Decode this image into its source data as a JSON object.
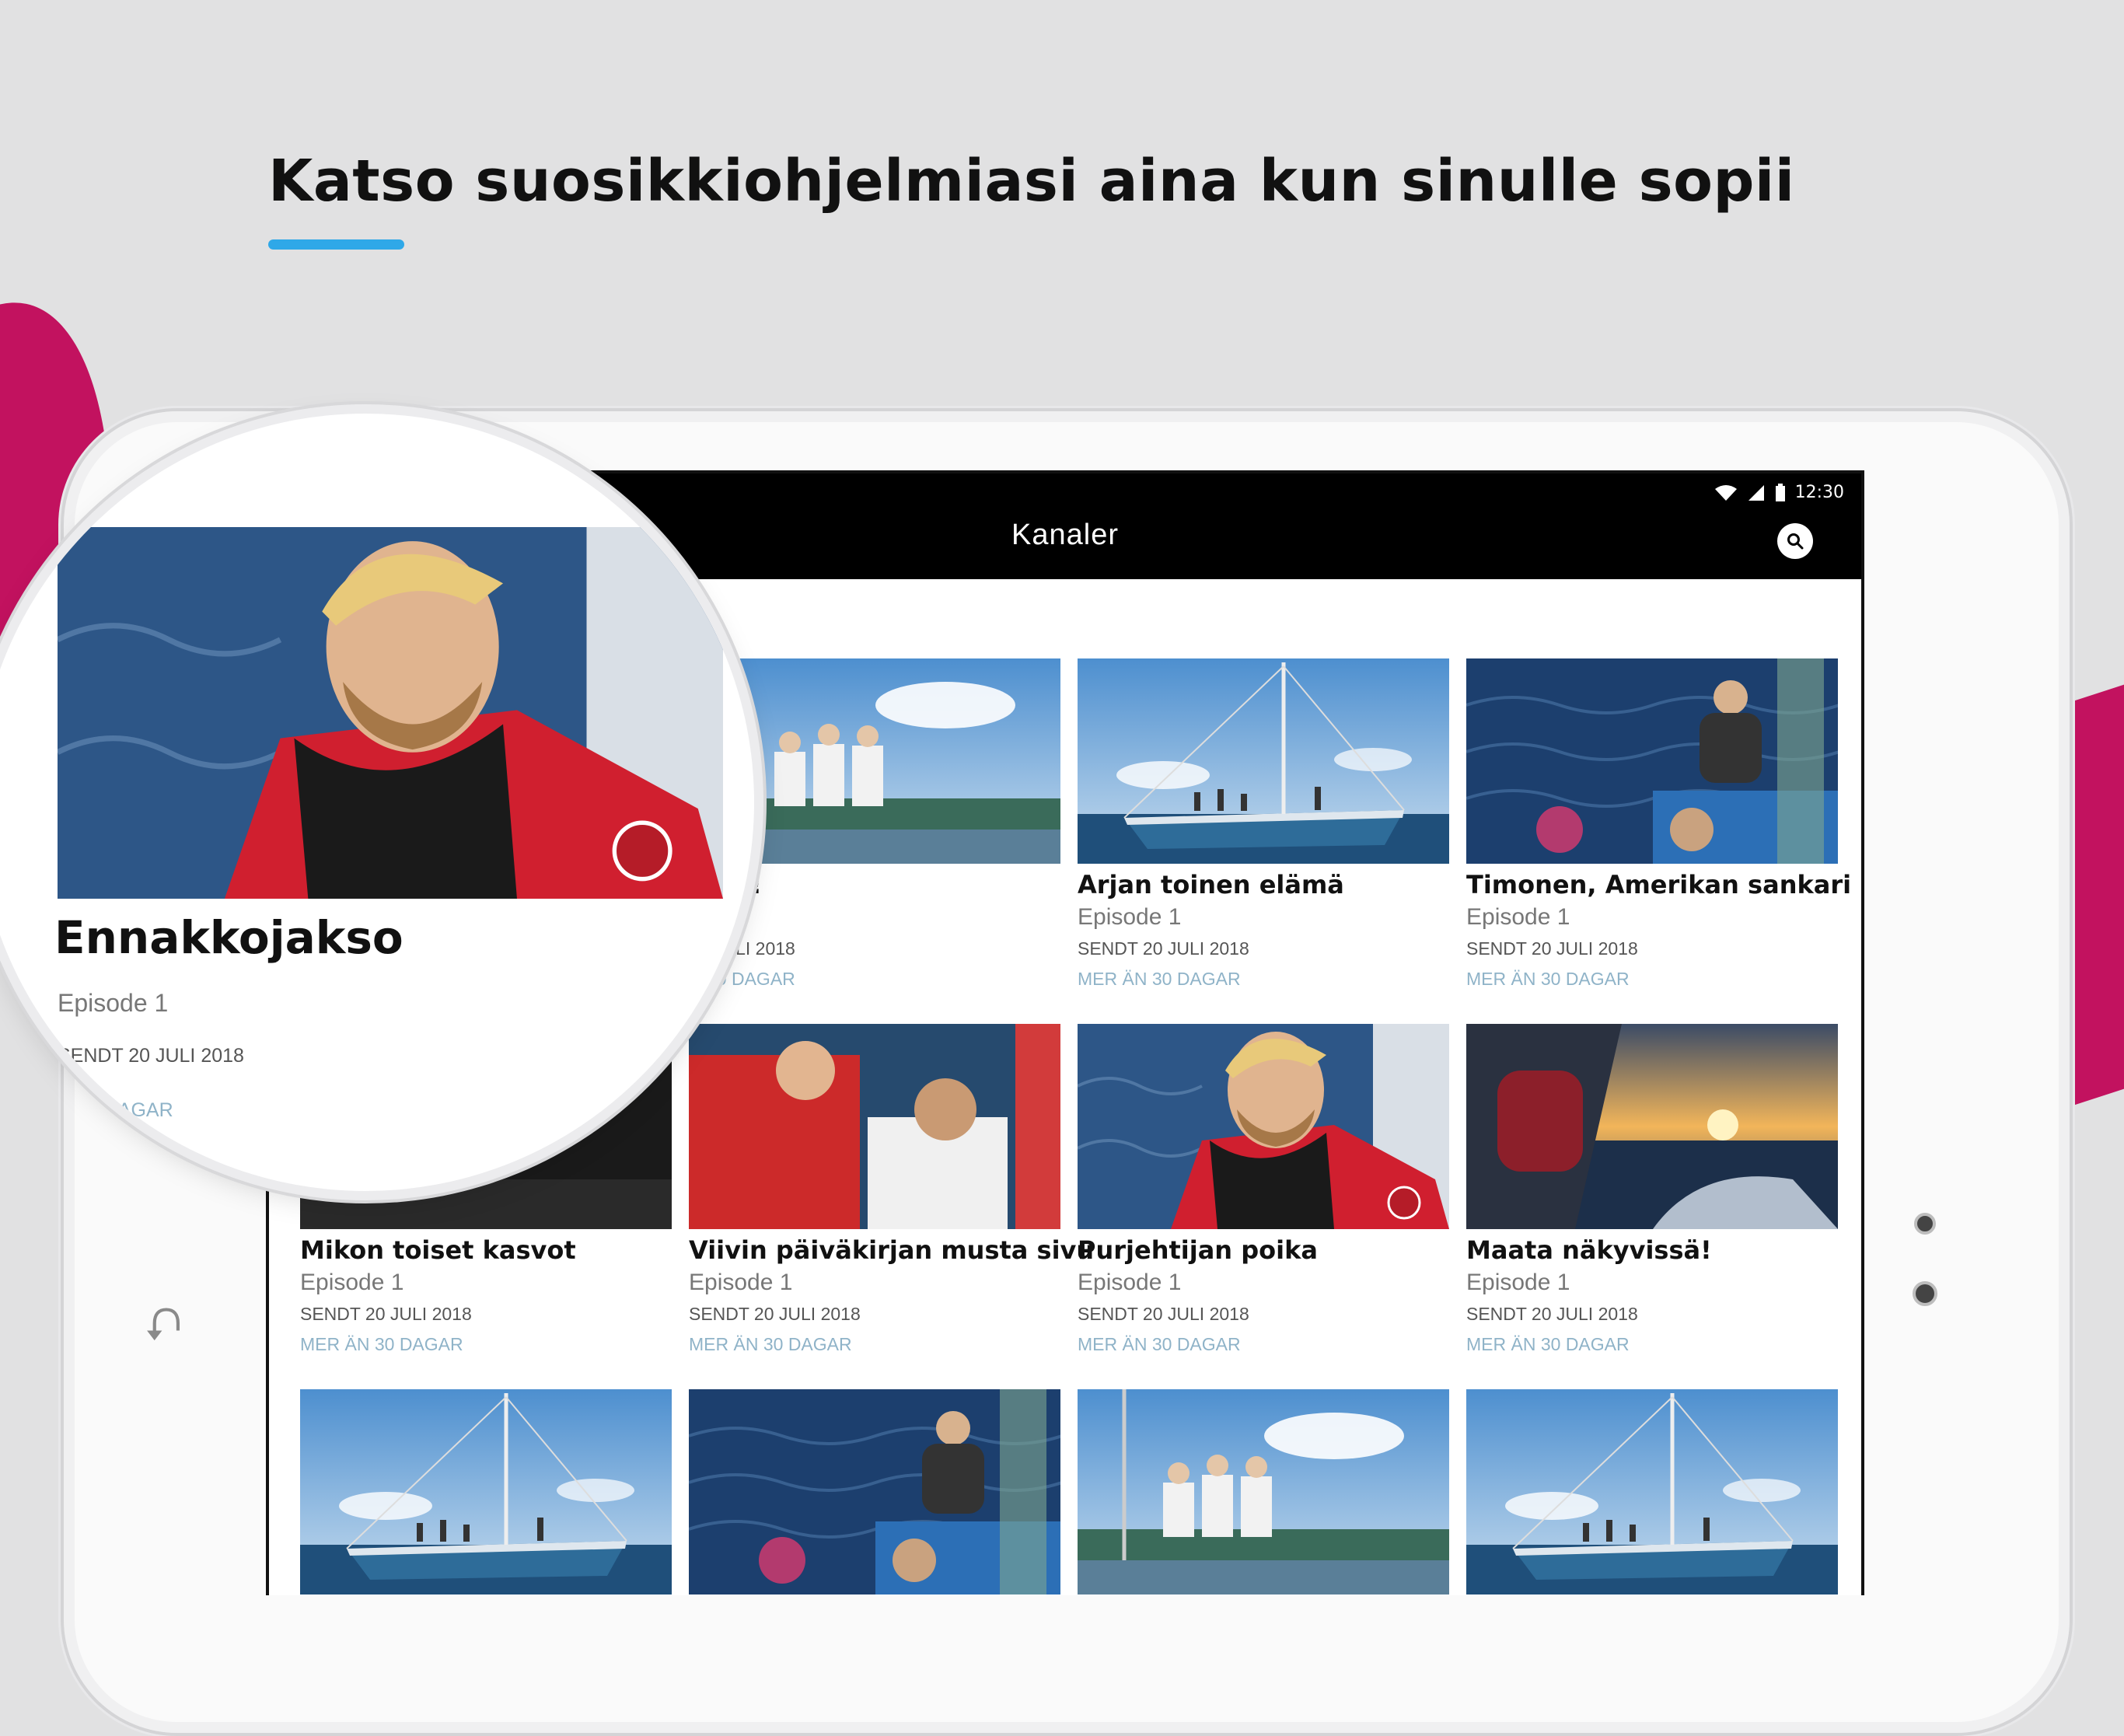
{
  "headline": "Katso suosikkiohjelmiasi aina kun sinulle sopii",
  "colors": {
    "accent": "#2fa8e8",
    "brand": "#c2125f",
    "appbar": "#000000"
  },
  "device": {
    "home_icon": "back-arrow-icon"
  },
  "app": {
    "status_time": "12:30",
    "status_icons": [
      "wifi-icon",
      "signal-icon",
      "battery-icon"
    ],
    "title": "Kanaler",
    "search_icon": "search-icon"
  },
  "zoom": {
    "title": "Ennakkojakso",
    "episode": "Episode 1",
    "sent": "SENDT 20 JULI 2018",
    "expiry_visible": "N 30 DAGAR",
    "thumb_scene": "portrait-red-jacket"
  },
  "cards": [
    {
      "title": "t irti!",
      "episode": "e 1",
      "sent": "20 JULI 2018",
      "expiry": "N 30 DAGAR",
      "scene": "crew-deck"
    },
    {
      "title": "Arjan toinen elämä",
      "episode": "Episode 1",
      "sent": "SENDT 20 JULI 2018",
      "expiry": "MER ÄN 30 DAGAR",
      "scene": "sailboat"
    },
    {
      "title": "Timonen, Amerikan sankari",
      "episode": "Episode 1",
      "sent": "SENDT 20 JULI 2018",
      "expiry": "MER ÄN 30 DAGAR",
      "scene": "sea-crew"
    },
    {
      "title": "Mikon toiset kasvot",
      "episode": "Episode 1",
      "sent": "SENDT 20 JULI 2018",
      "expiry": "MER ÄN 30 DAGAR",
      "scene": "dark"
    },
    {
      "title": "Viivin päiväkirjan musta sivu",
      "episode": "Episode 1",
      "sent": "SENDT 20 JULI 2018",
      "expiry": "MER ÄN 30 DAGAR",
      "scene": "red-crew"
    },
    {
      "title": "Purjehtijan poika",
      "episode": "Episode 1",
      "sent": "SENDT 20 JULI 2018",
      "expiry": "MER ÄN 30 DAGAR",
      "scene": "portrait-red-jacket"
    },
    {
      "title": "Maata näkyvissä!",
      "episode": "Episode 1",
      "sent": "SENDT 20 JULI 2018",
      "expiry": "MER ÄN 30 DAGAR",
      "scene": "sunset"
    },
    {
      "title": "",
      "episode": "",
      "sent": "",
      "expiry": "",
      "scene": "sailboat"
    },
    {
      "title": "",
      "episode": "",
      "sent": "",
      "expiry": "",
      "scene": "sea-crew"
    },
    {
      "title": "",
      "episode": "",
      "sent": "",
      "expiry": "",
      "scene": "crew-deck"
    },
    {
      "title": "",
      "episode": "",
      "sent": "",
      "expiry": "",
      "scene": "sailboat"
    }
  ]
}
